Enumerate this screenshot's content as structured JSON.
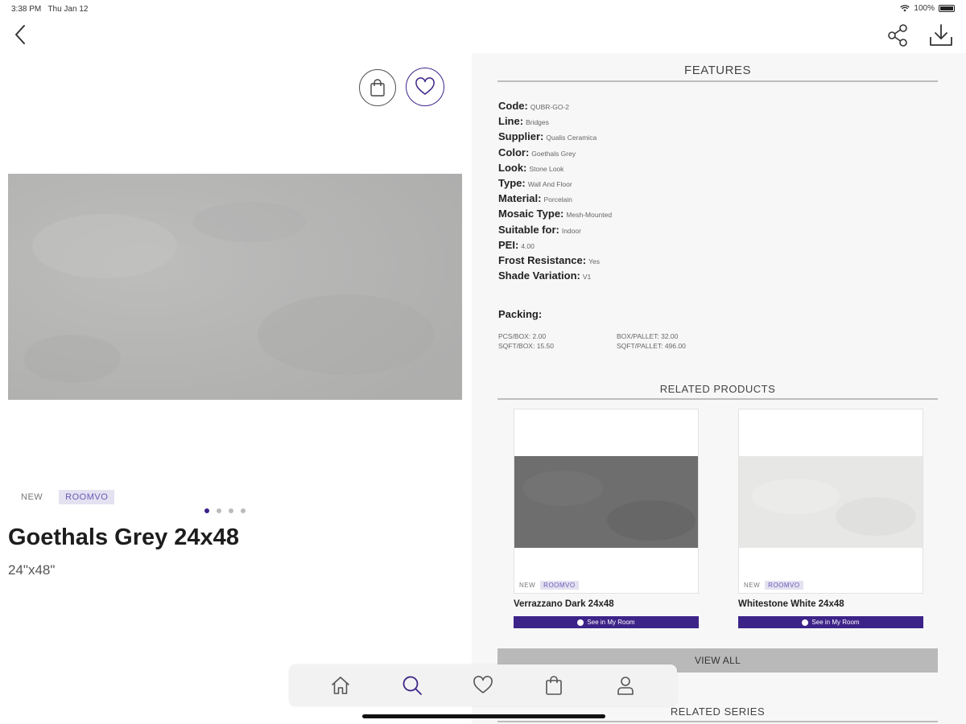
{
  "status_bar": {
    "time": "3:38 PM",
    "date": "Thu Jan 12",
    "battery": "100%"
  },
  "icons": {
    "back": "chevron-left-icon",
    "share": "share-icon",
    "download": "download-icon",
    "cart": "shopping-bag-icon",
    "favorite": "heart-icon"
  },
  "product": {
    "tag_new": "NEW",
    "tag_roomvo": "ROOMVO",
    "title": "Goethals Grey 24x48",
    "size": "24\"x48\"",
    "carousel": {
      "count": 4,
      "active_index": 1
    }
  },
  "features": {
    "title": "FEATURES",
    "rows": [
      {
        "label": "Code:",
        "value": "QUBR-GO-2"
      },
      {
        "label": "Line:",
        "value": "Bridges"
      },
      {
        "label": "Supplier:",
        "value": "Qualis Ceramica"
      },
      {
        "label": "Color:",
        "value": "Goethals Grey"
      },
      {
        "label": "Look:",
        "value": "Stone Look"
      },
      {
        "label": "Type:",
        "value": "Wall And Floor"
      },
      {
        "label": "Material:",
        "value": "Porcelain"
      },
      {
        "label": "Mosaic Type:",
        "value": "Mesh-Mounted"
      },
      {
        "label": "Suitable for:",
        "value": "Indoor"
      },
      {
        "label": "PEI:",
        "value": "4.00"
      },
      {
        "label": "Frost Resistance:",
        "value": "Yes"
      },
      {
        "label": "Shade Variation:",
        "value": "V1"
      }
    ]
  },
  "packing": {
    "label": "Packing:",
    "items": [
      "PCS/BOX: 2.00",
      "BOX/PALLET: 32.00",
      "SQFT/BOX: 15.50",
      "SQFT/PALLET: 496.00"
    ]
  },
  "related_products": {
    "title": "RELATED PRODUCTS",
    "items": [
      {
        "name": "Verrazzano Dark 24x48",
        "tag_new": "NEW",
        "tag_roomvo": "ROOMVO",
        "button": "See in My Room",
        "tile_color": "#6f6f6f"
      },
      {
        "name": "Whitestone White 24x48",
        "tag_new": "NEW",
        "tag_roomvo": "ROOMVO",
        "button": "See in My Room",
        "tile_color": "#e7e7e5"
      }
    ],
    "view_all": "VIEW ALL"
  },
  "related_series": {
    "title": "RELATED SERIES"
  },
  "tab_bar": {
    "tabs": [
      "home-icon",
      "search-icon",
      "heart-icon",
      "shopping-bag-icon",
      "user-icon"
    ]
  },
  "colors": {
    "accent": "#3c2388",
    "tag_bg": "#e4e1f1",
    "tag_text": "#6a5ab4",
    "panel_bg": "#f7f7f7",
    "tile_main": "#b5b5b4"
  }
}
